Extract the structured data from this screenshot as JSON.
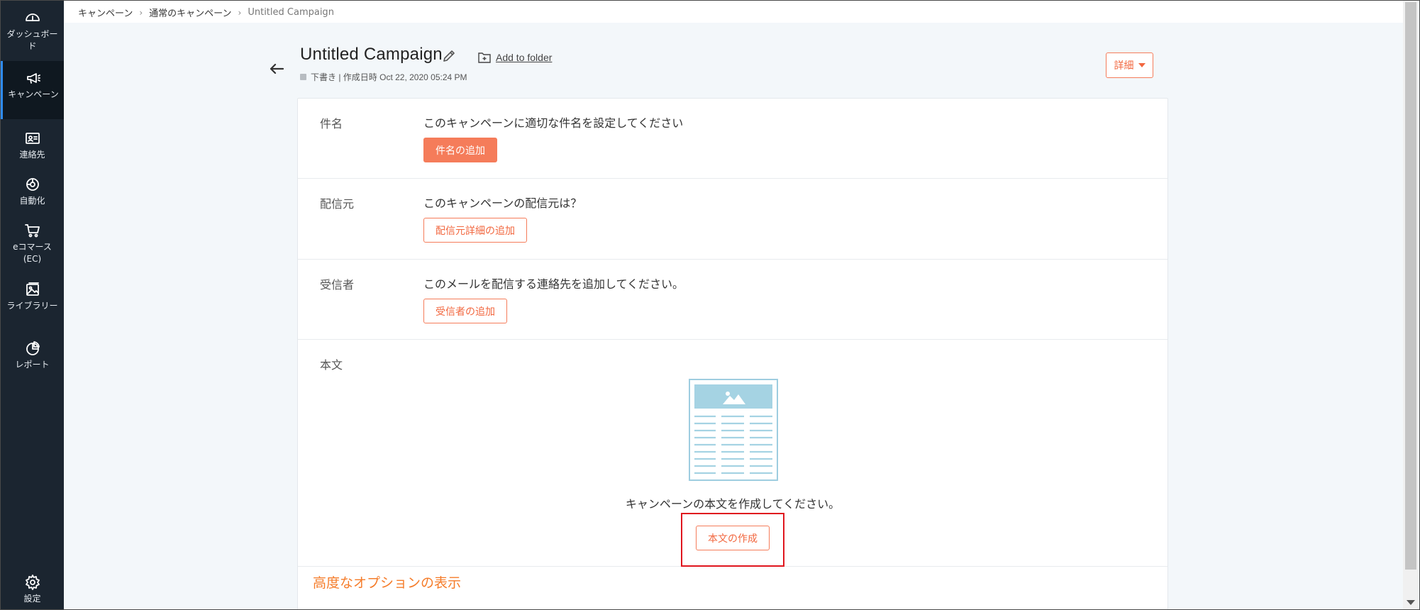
{
  "sidebar": {
    "items": [
      {
        "label": "ダッシュボード",
        "icon": "dashboard-icon"
      },
      {
        "label": "キャンペーン",
        "icon": "megaphone-icon",
        "active": true
      },
      {
        "label": "連絡先",
        "icon": "contacts-icon"
      },
      {
        "label": "自動化",
        "icon": "automation-icon"
      },
      {
        "label": "eコマース (EC)",
        "icon": "cart-icon"
      },
      {
        "label": "ライブラリー",
        "icon": "library-icon"
      },
      {
        "label": "レポート",
        "icon": "report-icon"
      }
    ],
    "settings": {
      "label": "設定",
      "icon": "gear-icon"
    }
  },
  "breadcrumb": {
    "items": [
      "キャンペーン",
      "通常のキャンペーン",
      "Untitled Campaign"
    ]
  },
  "header": {
    "title": "Untitled Campaign",
    "add_to_folder": "Add to folder",
    "meta": "下書き | 作成日時 Oct 22, 2020 05:24 PM",
    "details_button": "詳細"
  },
  "sections": {
    "subject": {
      "label": "件名",
      "text": "このキャンペーンに適切な件名を設定してください",
      "button": "件名の追加"
    },
    "sender": {
      "label": "配信元",
      "text": "このキャンペーンの配信元は？",
      "button": "配信元詳細の追加"
    },
    "recipients": {
      "label": "受信者",
      "text": "このメールを配信する連絡先を追加してください。",
      "button": "受信者の追加"
    },
    "body": {
      "label": "本文",
      "text": "キャンペーンの本文を作成してください。",
      "button": "本文の作成"
    }
  },
  "advanced_options": "高度なオプションの表示",
  "colors": {
    "sidebar": "#1b2530",
    "accent": "#f57c5a",
    "highlight": "#e0161e"
  }
}
